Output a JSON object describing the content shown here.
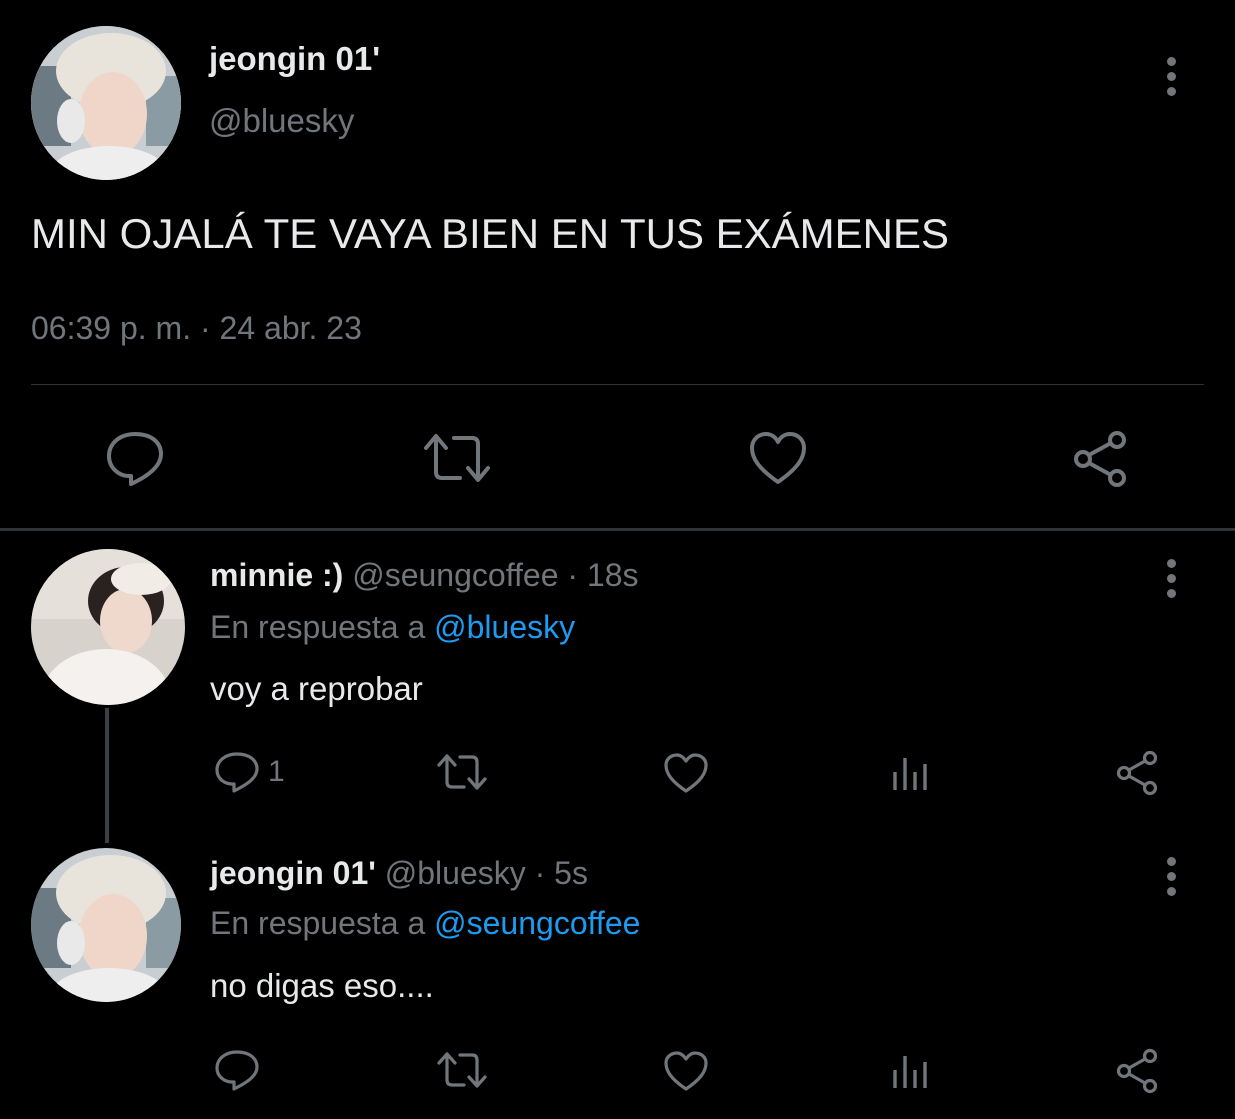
{
  "main_tweet": {
    "display_name": "jeongin 01'",
    "handle": "@bluesky",
    "text": "MIN OJALÁ TE VAYA BIEN EN TUS EXÁMENES",
    "timestamp": "06:39 p. m. · 24 abr. 23"
  },
  "replies": [
    {
      "display_name": "minnie :)",
      "handle": "@seungcoffee",
      "time": "· 18s",
      "reply_prefix": "En respuesta a",
      "reply_to": "@bluesky",
      "text": "voy a reprobar",
      "reply_count": "1"
    },
    {
      "display_name": "jeongin 01'",
      "handle": "@bluesky",
      "time": "· 5s",
      "reply_prefix": "En respuesta a",
      "reply_to": "@seungcoffee",
      "text": "no digas eso...."
    }
  ],
  "colors": {
    "background": "#000000",
    "muted": "#71767b",
    "link": "#1d9bf0",
    "divider": "#2f3336"
  },
  "icons": [
    "reply-icon",
    "retweet-icon",
    "like-icon",
    "share-icon",
    "analytics-icon",
    "more-options-icon"
  ]
}
